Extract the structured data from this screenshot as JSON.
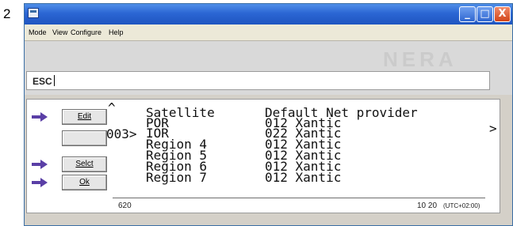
{
  "page_number": "2",
  "window": {
    "buttons": [
      "_",
      "□",
      "X"
    ]
  },
  "menubar": [
    "Mode",
    "View",
    "Configure",
    "Help"
  ],
  "watermark": "NERA",
  "command_line": {
    "label": "ESC"
  },
  "side_buttons": [
    {
      "label": "Edit",
      "has_arrow": true
    },
    {
      "label": "",
      "has_arrow": false
    },
    {
      "label": "Selct",
      "has_arrow": true
    },
    {
      "label": "Ok",
      "has_arrow": true
    }
  ],
  "table": {
    "scroll_up_indicator": "^",
    "headers": {
      "name": "Satellite",
      "provider": "Default Net provider"
    },
    "selection_marker": "003>",
    "rows": [
      {
        "name": "POR",
        "provider": "012 Xantic"
      },
      {
        "name": "IOR",
        "provider": "022 Xantic"
      },
      {
        "name": "Region 4",
        "provider": "012 Xantic"
      },
      {
        "name": "Region 5",
        "provider": "012 Xantic"
      },
      {
        "name": "Region 6",
        "provider": "012 Xantic"
      },
      {
        "name": "Region 7",
        "provider": "012 Xantic"
      }
    ],
    "right_indicator": ">"
  },
  "status_bar": {
    "left": "620",
    "time": "10 20",
    "timezone": "(UTC+02:00)"
  },
  "colors": {
    "titlebar": "#2b66d4",
    "arrow": "#5a3fa6",
    "window_bg": "#d4d0c8"
  }
}
